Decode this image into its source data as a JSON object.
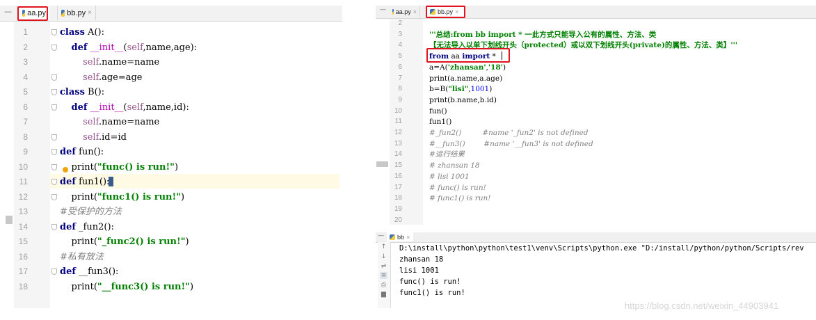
{
  "left_editor": {
    "tabs": [
      {
        "label": "aa.py",
        "close": "×"
      },
      {
        "label": "bb.py",
        "close": "×"
      }
    ],
    "lines": [
      {
        "n": "1",
        "tokens": [
          [
            "kw",
            "class"
          ],
          [
            "p",
            " A():"
          ]
        ]
      },
      {
        "n": "2",
        "tokens": [
          [
            "p",
            "    "
          ],
          [
            "kw",
            "def"
          ],
          [
            "p",
            " "
          ],
          [
            "magic",
            "__init__"
          ],
          [
            "p",
            "("
          ],
          [
            "self",
            "self"
          ],
          [
            "p",
            ",name,age):"
          ]
        ]
      },
      {
        "n": "3",
        "tokens": [
          [
            "p",
            "        "
          ],
          [
            "self",
            "self"
          ],
          [
            "p",
            ".name=name"
          ]
        ]
      },
      {
        "n": "4",
        "tokens": [
          [
            "p",
            "        "
          ],
          [
            "self",
            "self"
          ],
          [
            "p",
            ".age=age"
          ]
        ]
      },
      {
        "n": "5",
        "tokens": [
          [
            "kw",
            "class"
          ],
          [
            "p",
            " B():"
          ]
        ]
      },
      {
        "n": "6",
        "tokens": [
          [
            "p",
            "    "
          ],
          [
            "kw",
            "def"
          ],
          [
            "p",
            " "
          ],
          [
            "magic",
            "__init__"
          ],
          [
            "p",
            "("
          ],
          [
            "self",
            "self"
          ],
          [
            "p",
            ",name,id):"
          ]
        ]
      },
      {
        "n": "7",
        "tokens": [
          [
            "p",
            "        "
          ],
          [
            "self",
            "self"
          ],
          [
            "p",
            ".name=name"
          ]
        ]
      },
      {
        "n": "8",
        "tokens": [
          [
            "p",
            "        "
          ],
          [
            "self",
            "self"
          ],
          [
            "p",
            ".id=id"
          ]
        ]
      },
      {
        "n": "9",
        "tokens": [
          [
            "kw",
            "def"
          ],
          [
            "p",
            " fun():"
          ]
        ]
      },
      {
        "n": "10",
        "tokens": [
          [
            "p",
            "    print("
          ],
          [
            "str",
            "\"func() is run!\""
          ],
          [
            "p",
            ")"
          ]
        ]
      },
      {
        "n": "11",
        "tokens": [
          [
            "kw",
            "def"
          ],
          [
            "p",
            " fun1():"
          ]
        ]
      },
      {
        "n": "12",
        "tokens": [
          [
            "p",
            "    print("
          ],
          [
            "str",
            "\"func1() is run!\""
          ],
          [
            "p",
            ")"
          ]
        ]
      },
      {
        "n": "13",
        "tokens": [
          [
            "cmt",
            "#受保护的方法"
          ]
        ]
      },
      {
        "n": "14",
        "tokens": [
          [
            "kw",
            "def"
          ],
          [
            "p",
            " _fun2():"
          ]
        ]
      },
      {
        "n": "15",
        "tokens": [
          [
            "p",
            "    print("
          ],
          [
            "str",
            "\"_func2() is run!\""
          ],
          [
            "p",
            ")"
          ]
        ]
      },
      {
        "n": "16",
        "tokens": [
          [
            "cmt",
            "#私有放法"
          ]
        ]
      },
      {
        "n": "17",
        "tokens": [
          [
            "kw",
            "def"
          ],
          [
            "p",
            " __fun3():"
          ]
        ]
      },
      {
        "n": "18",
        "tokens": [
          [
            "p",
            "    print("
          ],
          [
            "str",
            "\"__func3() is run!\""
          ],
          [
            "p",
            ")"
          ]
        ]
      }
    ]
  },
  "right_editor": {
    "tabs": [
      {
        "label": "aa.py",
        "close": "×"
      },
      {
        "label": "bb.py",
        "close": "×"
      }
    ],
    "lines": [
      {
        "n": "2",
        "tokens": [
          [
            "p",
            ""
          ]
        ]
      },
      {
        "n": "3",
        "tokens": [
          [
            "docstr",
            "'''总结:from bb import * 一此方式只能导入公有的属性、方法、类"
          ]
        ]
      },
      {
        "n": "4",
        "tokens": [
          [
            "docstr",
            "【无法导入以单下划线开头（protected）或以双下划线开头(private)的属性、方法、类】'''"
          ]
        ]
      },
      {
        "n": "5",
        "tokens": [
          [
            "kw",
            "from"
          ],
          [
            "p",
            " aa "
          ],
          [
            "kw",
            "import"
          ],
          [
            "p",
            " *"
          ]
        ]
      },
      {
        "n": "6",
        "tokens": [
          [
            "p",
            "a=A("
          ],
          [
            "rstr",
            "'zhansan'"
          ],
          [
            "p",
            ","
          ],
          [
            "rstr",
            "'18'"
          ],
          [
            "p",
            ")"
          ]
        ]
      },
      {
        "n": "7",
        "tokens": [
          [
            "p",
            "print(a.name,a.age)"
          ]
        ]
      },
      {
        "n": "8",
        "tokens": [
          [
            "p",
            "b=B("
          ],
          [
            "rstr",
            "\"lisi\""
          ],
          [
            "p",
            ","
          ],
          [
            "num",
            "1001"
          ],
          [
            "p",
            ")"
          ]
        ]
      },
      {
        "n": "9",
        "tokens": [
          [
            "p",
            "print(b.name,b.id)"
          ]
        ]
      },
      {
        "n": "10",
        "tokens": [
          [
            "p",
            "fun()"
          ]
        ]
      },
      {
        "n": "11",
        "tokens": [
          [
            "p",
            "fun1()"
          ]
        ]
      },
      {
        "n": "12",
        "tokens": [
          [
            "rcmt",
            "#_fun2()         #name '_fun2' is not defined"
          ]
        ]
      },
      {
        "n": "13",
        "tokens": [
          [
            "rcmt",
            "#__fun3()        #name '__fun3' is not defined"
          ]
        ]
      },
      {
        "n": "14",
        "tokens": [
          [
            "rcmt",
            "#运行结果"
          ]
        ]
      },
      {
        "n": "15",
        "tokens": [
          [
            "rcmt",
            "# zhansan 18"
          ]
        ]
      },
      {
        "n": "16",
        "tokens": [
          [
            "rcmt",
            "# lisi 1001"
          ]
        ]
      },
      {
        "n": "17",
        "tokens": [
          [
            "rcmt",
            "# func() is run!"
          ]
        ]
      },
      {
        "n": "18",
        "tokens": [
          [
            "rcmt",
            "# func1() is run!"
          ]
        ]
      },
      {
        "n": "19",
        "tokens": [
          [
            "p",
            ""
          ]
        ]
      },
      {
        "n": "20",
        "tokens": [
          [
            "p",
            ""
          ]
        ]
      }
    ]
  },
  "run_panel": {
    "tab_label": "bb",
    "tab_close": "×",
    "output": [
      "D:\\install\\python\\python\\test1\\venv\\Scripts\\python.exe \"D:/install/python/python/Scripts/rev",
      "zhansan 18",
      "lisi 1001",
      "func() is run!",
      "func1() is run!"
    ]
  },
  "watermark": "https://blog.csdn.net/weixin_44903941",
  "colors": {
    "keyword": "#000080",
    "string": "#008000",
    "comment": "#808080",
    "highlight": "#e0141e"
  }
}
